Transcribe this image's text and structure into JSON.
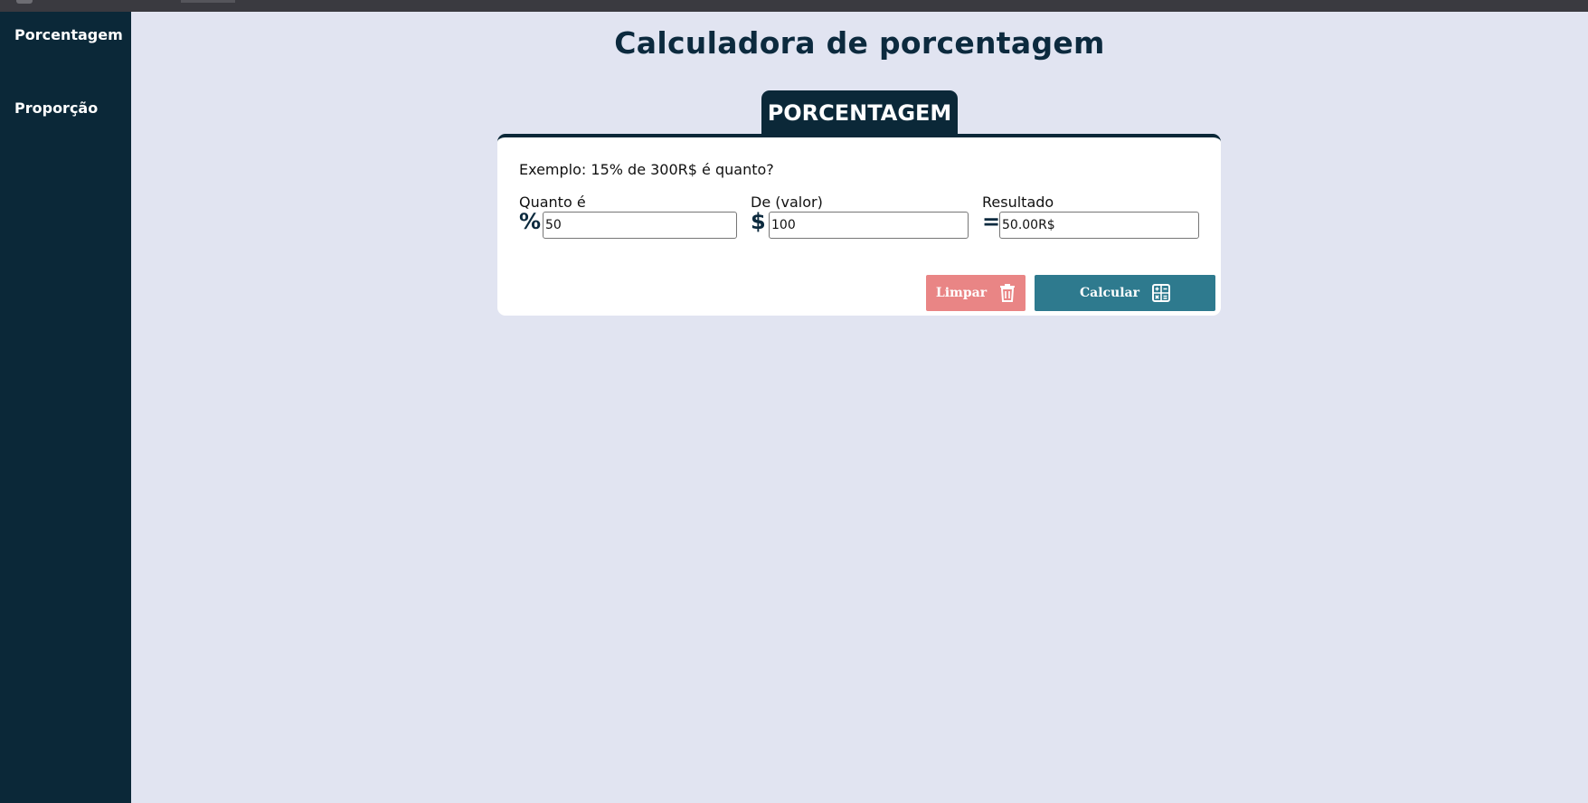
{
  "sidebar": {
    "items": [
      {
        "label": "Porcentagem"
      },
      {
        "label": "Proporção"
      }
    ]
  },
  "main": {
    "title": "Calculadora de porcentagem",
    "tab_label": "PORCENTAGEM",
    "example": "Exemplo: 15% de 300R$ é quanto?",
    "fields": [
      {
        "label": "Quanto é",
        "symbol": "%",
        "value": "50"
      },
      {
        "label": "De (valor)",
        "symbol": "$",
        "value": "100"
      },
      {
        "label": "Resultado",
        "symbol": "=",
        "value": "50.00R$"
      }
    ],
    "buttons": {
      "clear_label": "Limpar",
      "calc_label": "Calcular"
    }
  },
  "colors": {
    "sidebar_bg": "#0b2838",
    "page_bg": "#e1e4f1",
    "clear_button": "#e98585",
    "calc_button": "#2e7a8e"
  },
  "icons": [
    "trash-icon",
    "calculator-icon"
  ]
}
